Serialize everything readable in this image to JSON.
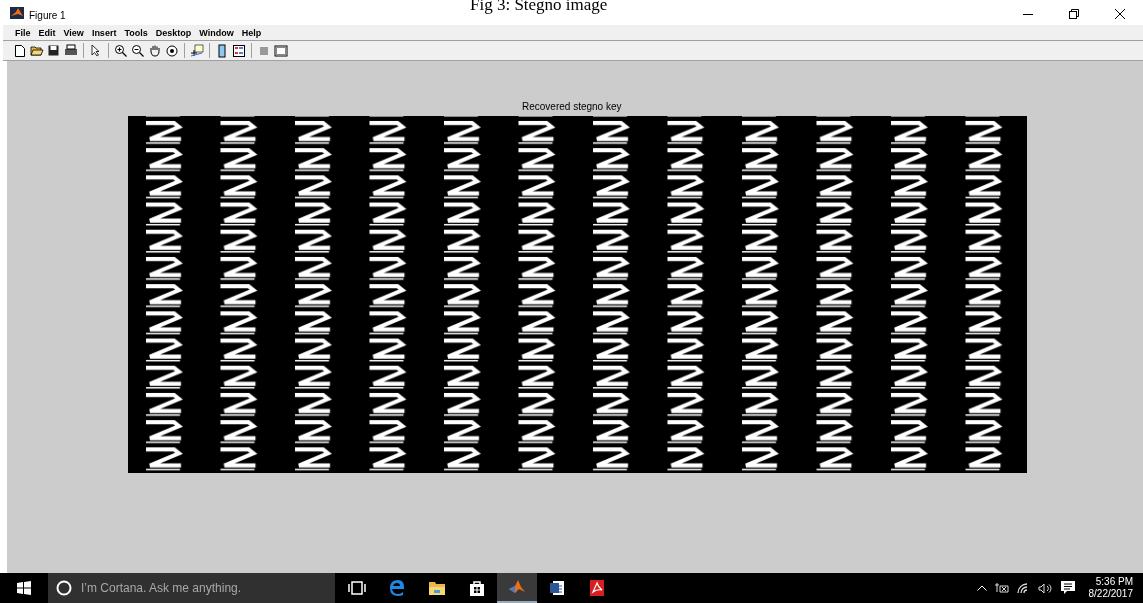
{
  "caption": "Fig 3: Stegno image",
  "window": {
    "title": "Figure 1"
  },
  "menu": [
    "File",
    "Edit",
    "View",
    "Insert",
    "Tools",
    "Desktop",
    "Window",
    "Help"
  ],
  "axes": {
    "title": "Recovered stegno key"
  },
  "taskbar": {
    "search": {
      "placeholder": "I’m Cortana. Ask me anything."
    },
    "apps": [
      {
        "kind": "taskview",
        "selected": false
      },
      {
        "kind": "edge",
        "selected": false
      },
      {
        "kind": "folder",
        "selected": false
      },
      {
        "kind": "store",
        "selected": false
      },
      {
        "kind": "matlab",
        "selected": true
      },
      {
        "kind": "word",
        "selected": false
      },
      {
        "kind": "pdf",
        "selected": false
      }
    ],
    "time": "5:36 PM",
    "date": "8/22/2017"
  }
}
